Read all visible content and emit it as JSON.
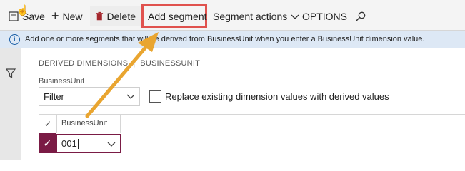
{
  "toolbar": {
    "save_label": "Save",
    "new_label": "New",
    "delete_label": "Delete",
    "add_segment_label": "Add segment",
    "segment_actions_label": "Segment actions",
    "options_label": "OPTIONS",
    "icons": {
      "save": "save-icon",
      "new": "plus-icon",
      "delete": "trash-icon",
      "segment_actions": "chevron-down-icon",
      "search": "search-icon"
    }
  },
  "info_bar": {
    "message": "Add one or more segments that will be derived from BusinessUnit when you enter a BusinessUnit dimension value.",
    "icon": "info-icon"
  },
  "breadcrumb": {
    "parent": "DERIVED DIMENSIONS",
    "current": "BUSINESSUNIT"
  },
  "filter": {
    "label": "BusinessUnit",
    "value": "Filter"
  },
  "replace_option": {
    "label": "Replace existing dimension values with derived values",
    "checked": false
  },
  "grid": {
    "column_header": "BusinessUnit",
    "rows": [
      {
        "value": "001",
        "selected": true
      }
    ]
  },
  "colors": {
    "highlight": "#e0524e",
    "arrow": "#e9a530",
    "row_selected": "#7a1b45",
    "info_bar": "#dde8f5"
  }
}
